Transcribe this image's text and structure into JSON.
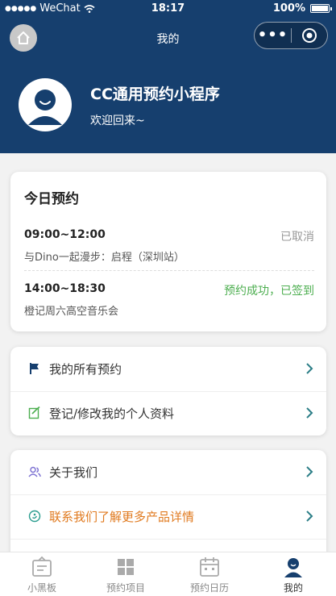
{
  "status_bar": {
    "carrier": "WeChat",
    "time": "18:17",
    "battery": "100%"
  },
  "nav": {
    "title": "我的"
  },
  "profile": {
    "app_name": "CC通用预约小程序",
    "welcome": "欢迎回来~"
  },
  "today": {
    "title": "今日预约",
    "appointments": [
      {
        "time": "09:00~12:00",
        "status": "已取消",
        "status_color": "#999999",
        "desc": "与Dino一起漫步：启程（深圳站）"
      },
      {
        "time": "14:00~18:30",
        "status": "预约成功，已签到",
        "status_color": "#4cae4f",
        "desc": "橙记周六高空音乐会"
      }
    ]
  },
  "menu_group1": [
    {
      "label": "我的所有预约",
      "icon": "flag-icon",
      "color": "#333333"
    },
    {
      "label": "登记/修改我的个人资料",
      "icon": "edit-icon",
      "color": "#333333"
    }
  ],
  "menu_group2": [
    {
      "label": "关于我们",
      "icon": "users-icon",
      "color": "#333333"
    },
    {
      "label": "联系我们了解更多产品详情",
      "icon": "contact-icon",
      "color": "#e07a1f"
    }
  ],
  "tabbar": [
    {
      "label": "小黑板",
      "icon": "board-icon",
      "active": false
    },
    {
      "label": "预约项目",
      "icon": "grid-icon",
      "active": false
    },
    {
      "label": "预约日历",
      "icon": "calendar-icon",
      "active": false
    },
    {
      "label": "我的",
      "icon": "user-icon",
      "active": true
    }
  ],
  "colors": {
    "header": "#163f6e",
    "arrow": "#2a7d86",
    "accent_orange": "#e07a1f",
    "success_green": "#4cae4f"
  }
}
